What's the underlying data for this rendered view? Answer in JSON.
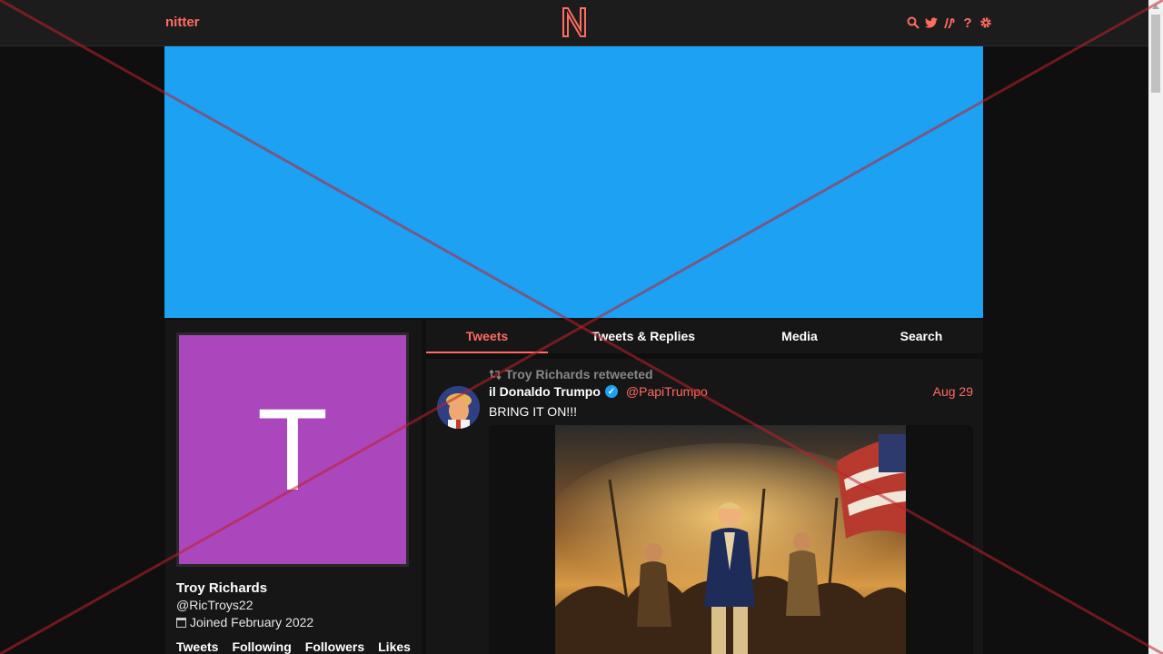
{
  "nav": {
    "brand": "nitter",
    "icons": [
      "search-icon",
      "twitter-icon",
      "rss-icon",
      "help-icon",
      "gear-icon"
    ],
    "help_glyph": "?"
  },
  "colors": {
    "accent": "#ff6c60",
    "banner": "#1da1f2",
    "avatar_bg": "#ab47bc",
    "page_bg": "#0f0f0f",
    "card_bg": "#161616"
  },
  "profile": {
    "avatar_letter": "T",
    "name": "Troy Richards",
    "handle": "@RicTroys22",
    "joined": "Joined February 2022",
    "stats": [
      "Tweets",
      "Following",
      "Followers",
      "Likes"
    ]
  },
  "tabs": [
    "Tweets",
    "Tweets & Replies",
    "Media",
    "Search"
  ],
  "active_tab": "Tweets",
  "tweet": {
    "retweet_text": "Troy Richards retweeted",
    "author_name": "il Donaldo Trumpo",
    "author_handle": "@PapiTrumpo",
    "date": "Aug 29",
    "text": "BRING IT ON!!!"
  }
}
